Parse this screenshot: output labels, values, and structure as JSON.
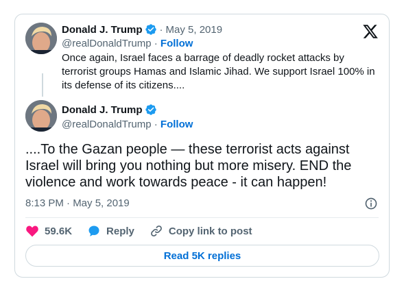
{
  "quoted_tweet": {
    "author_name": "Donald J. Trump",
    "separator": "·",
    "date": "May 5, 2019",
    "handle": "@realDonaldTrump",
    "follow_separator": "·",
    "follow_label": "Follow",
    "text": "Once again, Israel faces a barrage of deadly rocket attacks by terrorist groups Hamas and Islamic Jihad. We support Israel 100% in its defense of its citizens...."
  },
  "main_tweet": {
    "author_name": "Donald J. Trump",
    "handle": "@realDonaldTrump",
    "follow_separator": "·",
    "follow_label": "Follow",
    "text": "....To the Gazan people — these terrorist acts against Israel will bring you nothing but more misery. END the violence and work towards peace - it can happen!",
    "timestamp": "8:13 PM · May 5, 2019"
  },
  "actions": {
    "like_count": "59.6K",
    "reply_label": "Reply",
    "copy_label": "Copy link to post"
  },
  "read_replies_label": "Read 5K replies",
  "colors": {
    "like": "#f91880",
    "reply": "#1d9bf0",
    "verified": "#1d9bf0",
    "link": "#006fd6"
  },
  "icons": [
    "verified-badge-icon",
    "x-logo-icon",
    "info-icon",
    "heart-icon",
    "reply-bubble-icon",
    "link-icon"
  ]
}
